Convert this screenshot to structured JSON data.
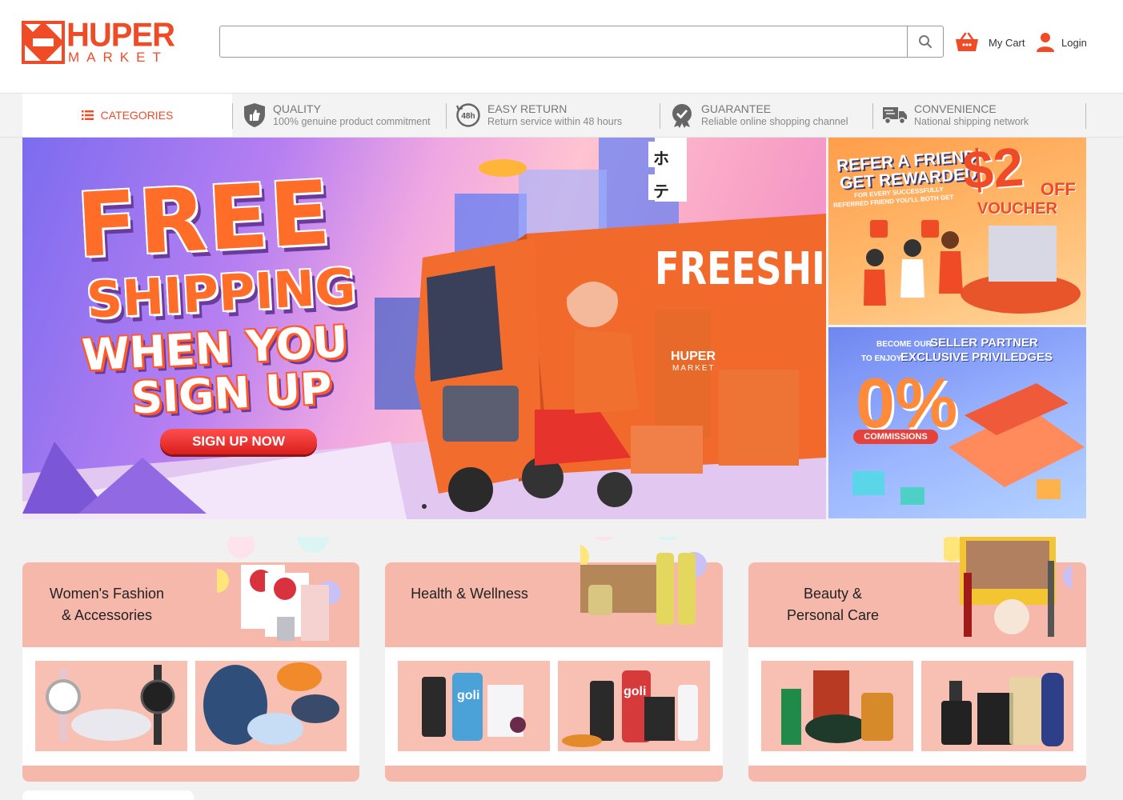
{
  "brand": {
    "name_top": "HUPER",
    "name_bottom": "MARKET",
    "color": "#ef4b27"
  },
  "search": {
    "placeholder": "",
    "value": ""
  },
  "header": {
    "cart_label": "My Cart",
    "login_label": "Login"
  },
  "features": {
    "categories_label": "CATEGORIES",
    "items": [
      {
        "title": "QUALITY",
        "subtitle": "100% genuine product commitment",
        "icon": "shield-thumb-icon"
      },
      {
        "title": "EASY RETURN",
        "subtitle": "Return service within 48 hours",
        "icon": "48h-return-icon"
      },
      {
        "title": "GUARANTEE",
        "subtitle": "Reliable online shopping channel",
        "icon": "badge-check-icon"
      },
      {
        "title": "CONVENIENCE",
        "subtitle": "National shipping network",
        "icon": "truck-icon"
      }
    ]
  },
  "hero": {
    "line1": "FREE",
    "line2": "SHIPPING",
    "line3": "WHEN YOU",
    "line4": "SIGN UP",
    "button": "SIGN UP NOW",
    "truck_text": "FREESHIP",
    "truck_brand": "HUPER",
    "truck_brand_sub": "MARKET",
    "sign_chars": [
      "ホ",
      "テ"
    ]
  },
  "side_banners": {
    "refer": {
      "line1": "REFER A FRIEND",
      "line2": "GET REWARDED",
      "small1": "FOR EVERY SUCCESSFULLY",
      "small2": "REFERRED FRIEND YOU'LL BOTH GET",
      "amount": "$2",
      "off": "OFF",
      "voucher": "VOUCHER"
    },
    "seller": {
      "small_a": "BECOME OUR",
      "big_a": "SELLER PARTNER",
      "small_b": "TO ENJOY",
      "big_b": "EXCLUSIVE PRIVILEDGES",
      "percent": "0%",
      "tag": "COMMISSIONS"
    }
  },
  "categories": [
    {
      "title_l1": "Women's Fashion",
      "title_l2": "& Accessories"
    },
    {
      "title_l1": "Health & Wellness",
      "title_l2": ""
    },
    {
      "title_l1": "Beauty &",
      "title_l2": "Personal Care"
    }
  ],
  "product_labels": {
    "goli": "goli"
  }
}
